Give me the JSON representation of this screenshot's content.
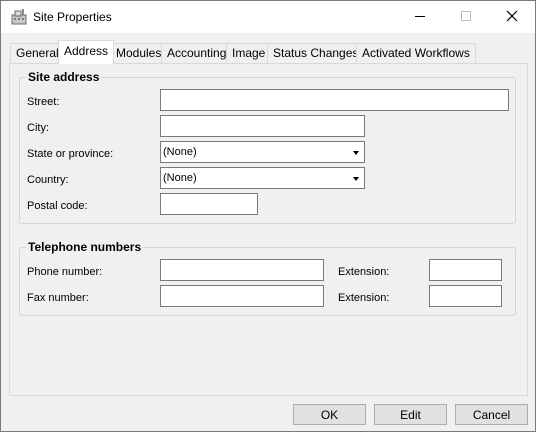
{
  "window": {
    "title": "Site Properties",
    "app_icon": "site-building-icon",
    "controls": [
      "minimize-icon",
      "maximize-icon",
      "close-icon"
    ]
  },
  "tabs": [
    {
      "label": "General",
      "active": false
    },
    {
      "label": "Address",
      "active": true
    },
    {
      "label": "Modules",
      "active": false
    },
    {
      "label": "Accounting",
      "active": false
    },
    {
      "label": "Image",
      "active": false
    },
    {
      "label": "Status Changes",
      "active": false
    },
    {
      "label": "Activated Workflows",
      "active": false
    }
  ],
  "site_address": {
    "title": "Site address",
    "street_label": "Street:",
    "street_value": "",
    "city_label": "City:",
    "city_value": "",
    "state_label": "State or province:",
    "state_value": "(None)",
    "country_label": "Country:",
    "country_value": "(None)",
    "postal_label": "Postal code:",
    "postal_value": ""
  },
  "telephone": {
    "title": "Telephone numbers",
    "phone_label": "Phone number:",
    "phone_value": "",
    "phone_ext_label": "Extension:",
    "phone_ext_value": "",
    "fax_label": "Fax number:",
    "fax_value": "",
    "fax_ext_label": "Extension:",
    "fax_ext_value": ""
  },
  "buttons": {
    "ok": "OK",
    "edit": "Edit",
    "cancel": "Cancel"
  },
  "colors": {
    "titlebar": "#ffffff",
    "window_bg": "#f0f0f0",
    "border": "#7a7a7a",
    "button_bg": "#e1e1e1"
  }
}
